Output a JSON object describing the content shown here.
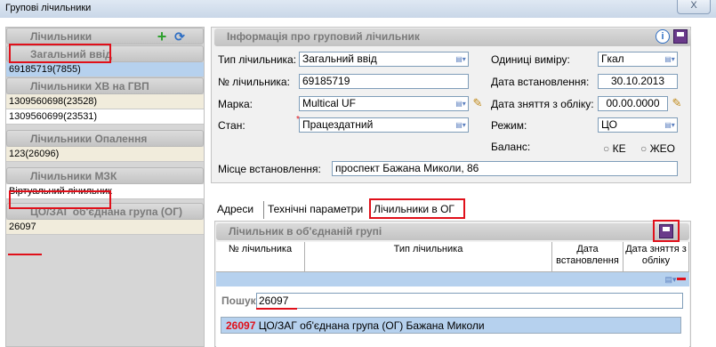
{
  "window": {
    "title": "Групові лічильники",
    "close_label": "X"
  },
  "left": {
    "header": "Лічильники",
    "groups": [
      {
        "header": "Загальний ввід",
        "items": [
          {
            "text": "69185719(7855)",
            "style": "blue"
          }
        ]
      },
      {
        "header": "Лічильники ХВ на ГВП",
        "items": [
          {
            "text": "1309560698(23528)",
            "style": "beige"
          },
          {
            "text": "1309560699(23531)",
            "style": "white"
          }
        ]
      },
      {
        "header": "Лічильники Опалення",
        "items": [
          {
            "text": "123(26096)",
            "style": "beige"
          }
        ]
      },
      {
        "header": "Лічильники МЗК",
        "items": [
          {
            "text": "Віртуальний лічильник",
            "style": "white"
          }
        ]
      },
      {
        "header": "ЦО/ЗАГ об'єднана група (ОГ)",
        "items": [
          {
            "text": "26097",
            "style": "beige"
          }
        ]
      }
    ]
  },
  "info": {
    "header": "Інформація про груповий лічильник",
    "type_label": "Тип лічильника:",
    "type_value": "Загальний ввід",
    "number_label": "№ лічильника:",
    "number_value": "69185719",
    "brand_label": "Марка:",
    "brand_value": "Multical UF",
    "state_label": "Стан:",
    "state_value": "Працездатний",
    "units_label": "Одиниці виміру:",
    "units_value": "Гкал",
    "install_label": "Дата встановлення:",
    "install_value": "30.10.2013",
    "remove_label": "Дата зняття з обліку:",
    "remove_value": "00.00.0000",
    "mode_label": "Режим:",
    "mode_value": "ЦО",
    "balance_label": "Баланс:",
    "balance_ke": "КЕ",
    "balance_zheo": "ЖЕО",
    "place_label": "Місце встановлення:",
    "place_value": "проспект Бажана Миколи, 86"
  },
  "tabs": [
    "Адреси",
    "Технічні параметри",
    "Лічильники в ОГ"
  ],
  "og": {
    "header": "Лічильник в об'єднаній групі",
    "col_number": "№ лічильника",
    "col_type": "Тип лічильника",
    "col_install_1": "Дата",
    "col_install_2": "встановлення",
    "col_remove_1": "Дата зняття з",
    "col_remove_2": "обліку",
    "search_label": "Пошук:",
    "search_value": "26097",
    "result_code": "26097",
    "result_text": " ЦО/ЗАГ об'єднана група (ОГ) Бажана Миколи"
  },
  "colors": {
    "accent_red": "#e0101a",
    "selection_blue": "#b6d1ee",
    "green_plus": "#2ea02e"
  }
}
